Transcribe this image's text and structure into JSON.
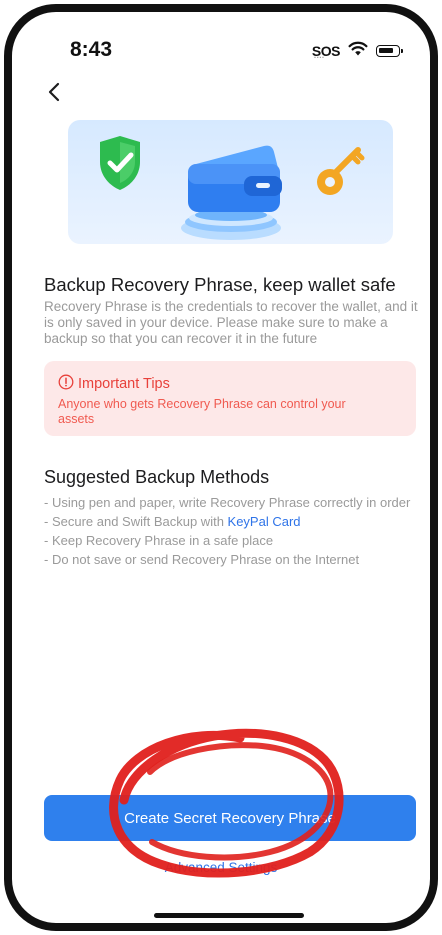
{
  "status_bar": {
    "time": "8:43",
    "sos": "SOS"
  },
  "icons": {
    "back": "chevron-left-icon",
    "shield": "shield-check-icon",
    "wallet": "wallet-icon",
    "key": "key-icon",
    "tips": "alert-circle-icon",
    "wifi": "wifi-icon",
    "battery": "battery-icon"
  },
  "main": {
    "title": "Backup Recovery Phrase, keep wallet safe",
    "description": "Recovery Phrase is the credentials to recover the wallet, and it is only saved in your device. Please make sure to make a backup so that you can recover it in the future"
  },
  "tips": {
    "title": "Important Tips",
    "text": "Anyone who gets Recovery Phrase can control your assets"
  },
  "methods": {
    "title": "Suggested Backup Methods",
    "items": [
      "- Using pen and paper, write Recovery Phrase correctly in order",
      "- Secure and Swift Backup with ",
      "- Keep Recovery Phrase in a safe place",
      "- Do not save or send Recovery Phrase on the Internet"
    ],
    "link_label": "KeyPal Card"
  },
  "actions": {
    "primary_label": "Create Secret Recovery Phrase",
    "secondary_label": "Advanced Settings"
  },
  "colors": {
    "accent": "#2f80ed",
    "tips_bg": "#fde8e8",
    "tips_text": "#e8413b",
    "annotation": "#e0201c"
  }
}
